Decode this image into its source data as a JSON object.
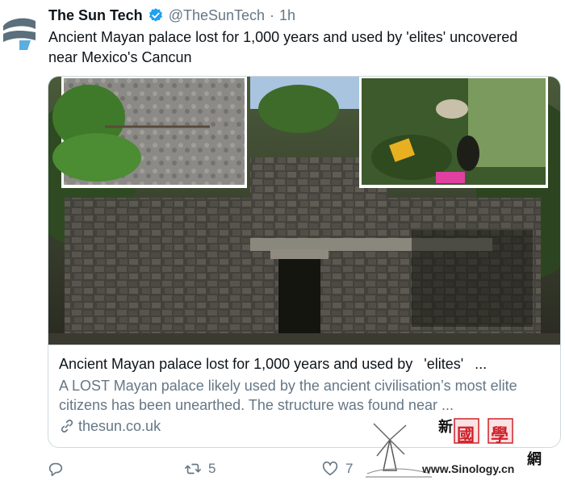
{
  "tweet": {
    "author_name": "The Sun Tech",
    "handle": "@TheSunTech",
    "separator": "·",
    "time": "1h",
    "text": "Ancient Mayan palace lost for 1,000 years and used by 'elites' uncovered near Mexico's Cancun",
    "verified": true
  },
  "card": {
    "title": "Ancient Mayan palace lost for 1,000 years and used by  'elites'  ...",
    "description": "A LOST Mayan palace likely used by the ancient civilisation’s most elite citizens has been unearthed. The structure was found near ...",
    "domain": "thesun.co.uk"
  },
  "actions": {
    "reply_count": "",
    "retweet_count": "5",
    "like_count": "7"
  },
  "watermark": {
    "chars": [
      "新",
      "國",
      "學",
      "網"
    ],
    "url": "www.Sinology.cn"
  },
  "colors": {
    "accent": "#1da1f2",
    "text_primary": "#0f1419",
    "text_secondary": "#657786",
    "border": "#cfd9de",
    "watermark_red": "#d0202a"
  },
  "icons": {
    "avatar": "the-sun-logo-icon",
    "verified": "verified-badge-icon",
    "link": "link-icon",
    "reply": "reply-icon",
    "retweet": "retweet-icon",
    "like": "heart-icon"
  }
}
